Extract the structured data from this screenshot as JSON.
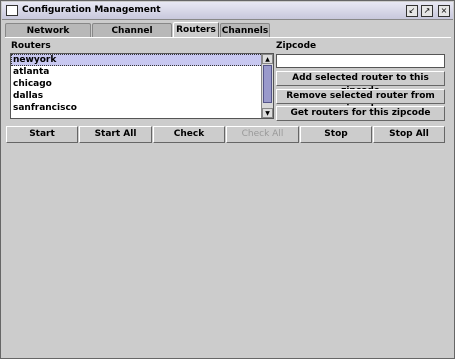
{
  "window": {
    "title": "Configuration Management"
  },
  "tabs": [
    {
      "label": "Network Topology",
      "active": false
    },
    {
      "label": "Channel Service",
      "active": false
    },
    {
      "label": "Routers",
      "active": true
    },
    {
      "label": "Channels",
      "active": false
    }
  ],
  "routers": {
    "label": "Routers",
    "items": [
      "newyork",
      "atlanta",
      "chicago",
      "dallas",
      "sanfrancisco"
    ],
    "selected": "newyork"
  },
  "zipcode": {
    "label": "Zipcode",
    "value": "",
    "add_label": "Add selected router to this zipcode",
    "remove_label": "Remove selected router from zipcode",
    "get_label": "Get routers for this zipcode"
  },
  "actions": {
    "start": "Start",
    "start_all": "Start All",
    "check": "Check",
    "check_all": "Check All",
    "stop": "Stop",
    "stop_all": "Stop All"
  },
  "colors": {
    "selection": "#c8c8f0",
    "scroll_thumb": "#9a9acb",
    "background": "#cccccc"
  }
}
